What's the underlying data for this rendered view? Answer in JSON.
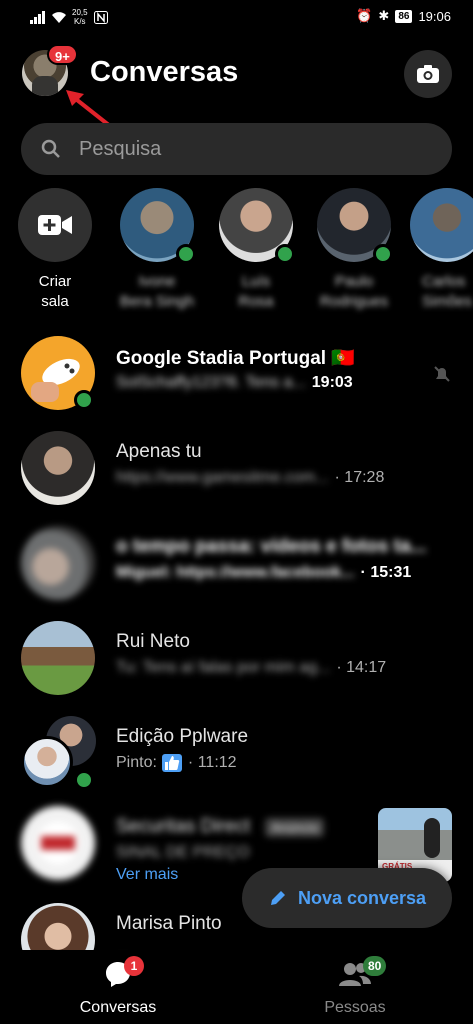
{
  "status_bar": {
    "speed_value": "20,5",
    "speed_unit": "K/s",
    "battery": "86",
    "time": "19:06"
  },
  "header": {
    "title": "Conversas",
    "avatar_badge": "9+",
    "icons": [
      "camera-icon"
    ]
  },
  "search": {
    "placeholder": "Pesquisa"
  },
  "stories": {
    "create_label_line1": "Criar",
    "create_label_line2": "sala",
    "people": [
      {
        "line1": "Ivone",
        "line2": "Bera Singh"
      },
      {
        "line1": "Luís",
        "line2": "Rosa"
      },
      {
        "line1": "Paulo",
        "line2": "Rodrigues"
      },
      {
        "line1": "Carlos",
        "line2": "Simões"
      }
    ]
  },
  "chats": [
    {
      "title": "Google Stadia Portugal 🇵🇹",
      "preview": "SolSchaffy123?8. Tens a...",
      "time": "19:03"
    },
    {
      "title": "Apenas tu",
      "preview": "https://www.gamesitme.com...",
      "time": "17:28"
    },
    {
      "title": "o tempo passa: vídeos e fotos ta...",
      "preview": "Miguel: https://www.facebook...",
      "time": "15:31"
    },
    {
      "title": "Rui Neto",
      "preview": "Tu: Tens aí falas por mim ag...",
      "time": "14:17"
    },
    {
      "title": "Edição Pplware",
      "preview": "Pinto:",
      "time": "11:12"
    },
    {
      "title": "Securitas Direct",
      "tag": "Anúncio",
      "preview": "SINAL DE PREÇO",
      "ver_mais": "Ver mais"
    },
    {
      "title": "Marisa Pinto",
      "preview": "..."
    }
  ],
  "fab": {
    "label": "Nova conversa"
  },
  "bottom_nav": {
    "conversas": {
      "label": "Conversas",
      "badge": "1"
    },
    "pessoas": {
      "label": "Pessoas",
      "badge": "80"
    }
  },
  "colors": {
    "accent": "#4d9ff5",
    "badge_red": "#e7333a",
    "online_green": "#31a24c"
  }
}
